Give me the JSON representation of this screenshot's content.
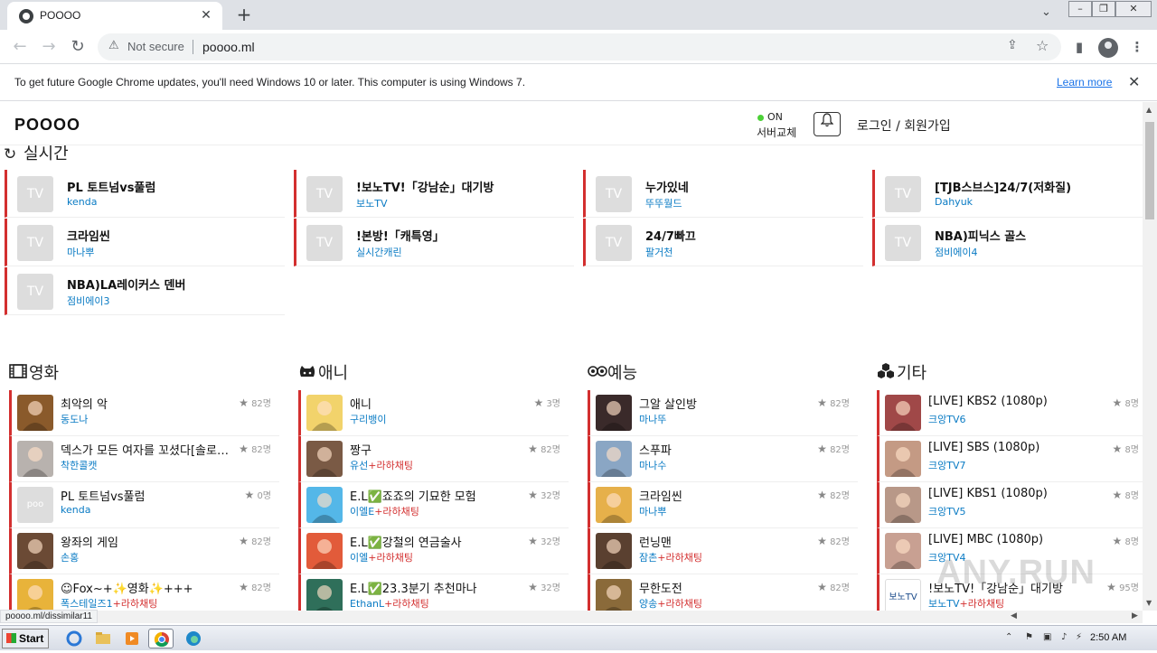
{
  "browser": {
    "tab_title": "POOOO",
    "url": "poooo.ml",
    "not_secure": "Not secure",
    "infobar_message": "To get future Google Chrome updates, you'll need Windows 10 or later. This computer is using Windows 7.",
    "infobar_link": "Learn more",
    "status_url": "poooo.ml/dissimilar11"
  },
  "header": {
    "logo": "POOOO",
    "server_status": "ON",
    "server_change": "서버교체",
    "login": "로그인 / 회원가입"
  },
  "live": {
    "title": "실시간",
    "items": [
      {
        "title": "PL 토트넘vs풀럼",
        "sub": "kenda",
        "thumb": "TV"
      },
      {
        "title": "!보노TV!「강남순」대기방",
        "sub": "보노TV",
        "thumb": "TV"
      },
      {
        "title": "누가있네",
        "sub": "뚜뚜월드",
        "thumb": "TV"
      },
      {
        "title": "[TJB스브스]24/7(저화질)",
        "sub": "Dahyuk",
        "thumb": "TV"
      },
      {
        "title": "크라임씬",
        "sub": "마나뿌",
        "thumb": "TV"
      },
      {
        "title": "!본방!「캐특영」",
        "sub": "실시간캐린",
        "thumb": "TV"
      },
      {
        "title": "24/7빠끄",
        "sub": "팔거천",
        "thumb": "TV"
      },
      {
        "title": "NBA)피닉스 골스",
        "sub": "점비에이4",
        "thumb": "TV"
      },
      {
        "title": "NBA)LA레이커스 덴버",
        "sub": "점비에이3",
        "thumb": "TV"
      }
    ]
  },
  "categories": [
    {
      "title": "영화",
      "icon": "film-icon",
      "items": [
        {
          "title": "최악의 악",
          "sub": "동도나",
          "suffix": "",
          "viewers": "82명",
          "avatar": "#8a5a2b"
        },
        {
          "title": "덱스가 모든 여자를 꼬셨다[솔로지옥]",
          "sub": "착한콜캣",
          "suffix": "",
          "viewers": "82명",
          "avatar": "#b8b2ae"
        },
        {
          "title": "PL 토트넘vs풀럼",
          "sub": "kenda",
          "suffix": "",
          "viewers": "0명",
          "avatar": "#dddddd",
          "avatar_text": "poo"
        },
        {
          "title": "왕좌의 게임",
          "sub": "손홍",
          "suffix": "",
          "viewers": "82명",
          "avatar": "#6b4a35"
        },
        {
          "title": "☺Fox~+✨영화✨+++",
          "sub": "폭스테일즈1",
          "suffix": "+라하채팅",
          "viewers": "82명",
          "avatar": "#e8b33a"
        }
      ]
    },
    {
      "title": "애니",
      "icon": "cat-icon",
      "items": [
        {
          "title": "애니",
          "sub": "구리뱅이",
          "suffix": "",
          "viewers": "3명",
          "avatar": "#f2d36b"
        },
        {
          "title": "짱구",
          "sub": "유선",
          "suffix": "+라하채팅",
          "viewers": "82명",
          "avatar": "#7a5a45"
        },
        {
          "title": "E.L✅죠죠의 기묘한 모험",
          "sub": "이엘E",
          "suffix": "+라하채팅",
          "viewers": "32명",
          "avatar": "#54b7e8"
        },
        {
          "title": "E.L✅강철의 연금술사",
          "sub": "이엘",
          "suffix": "+라하채팅",
          "viewers": "32명",
          "avatar": "#e25b3a"
        },
        {
          "title": "E.L✅23.3분기 추천마나",
          "sub": "EthanL",
          "suffix": "+라하채팅",
          "viewers": "32명",
          "avatar": "#2f6f5a"
        }
      ]
    },
    {
      "title": "예능",
      "icon": "mask-icon",
      "items": [
        {
          "title": "그알 살인방",
          "sub": "마나뚜",
          "suffix": "",
          "viewers": "82명",
          "avatar": "#3a2a2a"
        },
        {
          "title": "스푸파",
          "sub": "마나수",
          "suffix": "",
          "viewers": "82명",
          "avatar": "#8aa6c4"
        },
        {
          "title": "크라임씬",
          "sub": "마나뿌",
          "suffix": "",
          "viewers": "82명",
          "avatar": "#e6b04a"
        },
        {
          "title": "런닝맨",
          "sub": "잠촌",
          "suffix": "+라하채팅",
          "viewers": "82명",
          "avatar": "#5a4030"
        },
        {
          "title": "무한도전",
          "sub": "양송",
          "suffix": "+라하채팅",
          "viewers": "82명",
          "avatar": "#8a6a3a"
        }
      ]
    },
    {
      "title": "기타",
      "icon": "boxes-icon",
      "items": [
        {
          "title": "[LIVE] KBS2 (1080p)",
          "sub": "크앙TV6",
          "suffix": "",
          "viewers": "8명",
          "avatar": "#a04848"
        },
        {
          "title": "[LIVE] SBS (1080p)",
          "sub": "크앙TV7",
          "suffix": "",
          "viewers": "8명",
          "avatar": "#c49a84"
        },
        {
          "title": "[LIVE] KBS1 (1080p)",
          "sub": "크앙TV5",
          "suffix": "",
          "viewers": "8명",
          "avatar": "#b89888"
        },
        {
          "title": "[LIVE] MBC (1080p)",
          "sub": "크앙TV4",
          "suffix": "",
          "viewers": "8명",
          "avatar": "#c8a092"
        },
        {
          "title": "!보노TV!「강남순」대기방",
          "sub": "보노TV",
          "suffix": "+라하채팅",
          "viewers": "95명",
          "avatar": "#ffffff",
          "avatar_text": "보노TV"
        }
      ]
    }
  ],
  "taskbar": {
    "start": "Start",
    "clock": "2:50 AM"
  },
  "watermark": "ANY.RUN",
  "colors": {
    "accent_red": "#d32f2f",
    "link_blue": "#0a7bc4",
    "online_green": "#4cd137"
  }
}
